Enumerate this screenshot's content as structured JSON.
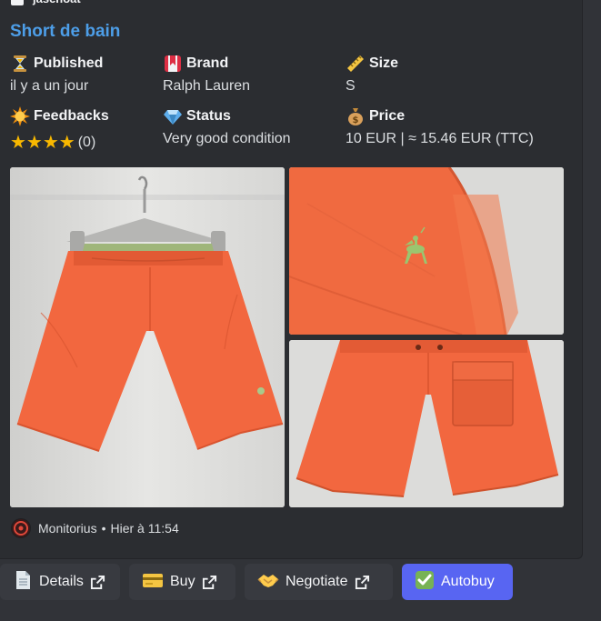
{
  "author": {
    "name": "jasenoat"
  },
  "title": "Short de bain",
  "fields": {
    "published": {
      "label": "Published",
      "value": "il y a un jour",
      "icon": "hourglass-icon"
    },
    "brand": {
      "label": "Brand",
      "value": "Ralph Lauren",
      "icon": "bookmark-icon"
    },
    "size": {
      "label": "Size",
      "value": "S",
      "icon": "ruler-icon"
    },
    "feedbacks": {
      "label": "Feedbacks",
      "stars": "★★★★",
      "value": "(0)",
      "icon": "sun-icon",
      "rating": 4
    },
    "status": {
      "label": "Status",
      "value": "Very good condition",
      "icon": "gem-icon"
    },
    "price": {
      "label": "Price",
      "value": "10 EUR | ≈ 15.46 EUR (TTC)",
      "icon": "money-bag-icon"
    }
  },
  "footer": {
    "name": "Monitorius",
    "separator": "•",
    "time": "Hier à 11:54"
  },
  "buttons": {
    "details": "Details",
    "buy": "Buy",
    "negotiate": "Negotiate",
    "autobuy": "Autobuy"
  },
  "colors": {
    "title": "#4d9ee8",
    "shorts": "#f2673f",
    "autobuy": "#5865f2",
    "star": "#f8b800"
  }
}
